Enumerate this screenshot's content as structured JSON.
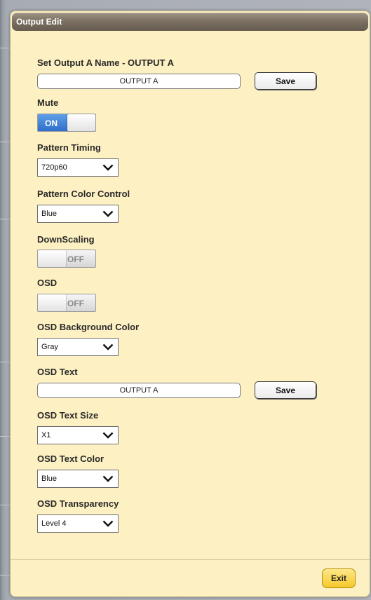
{
  "dialog": {
    "title": "Output Edit",
    "exit_label": "Exit"
  },
  "name_section": {
    "label": "Set Output A Name - OUTPUT A",
    "value": "OUTPUT A",
    "save_label": "Save"
  },
  "mute": {
    "label": "Mute",
    "state_text": "ON",
    "is_on": true
  },
  "pattern_timing": {
    "label": "Pattern Timing",
    "selected": "720p60"
  },
  "pattern_color": {
    "label": "Pattern Color Control",
    "selected": "Blue"
  },
  "downscaling": {
    "label": "DownScaling",
    "state_text": "OFF",
    "is_on": false
  },
  "osd": {
    "label": "OSD",
    "state_text": "OFF",
    "is_on": false
  },
  "osd_bg_color": {
    "label": "OSD Background Color",
    "selected": "Gray"
  },
  "osd_text": {
    "label": "OSD Text",
    "value": "OUTPUT A",
    "save_label": "Save"
  },
  "osd_text_size": {
    "label": "OSD Text Size",
    "selected": "X1"
  },
  "osd_text_color": {
    "label": "OSD Text Color",
    "selected": "Blue"
  },
  "osd_transparency": {
    "label": "OSD Transparency",
    "selected": "Level 4"
  },
  "colors": {
    "dialog_bg": "#fdf0c2",
    "titlebar": "#7a6f62",
    "toggle_on": "#2f6fcb",
    "exit_button": "#f6c92a"
  },
  "icons": {
    "select_caret": "chevron-down-icon"
  }
}
